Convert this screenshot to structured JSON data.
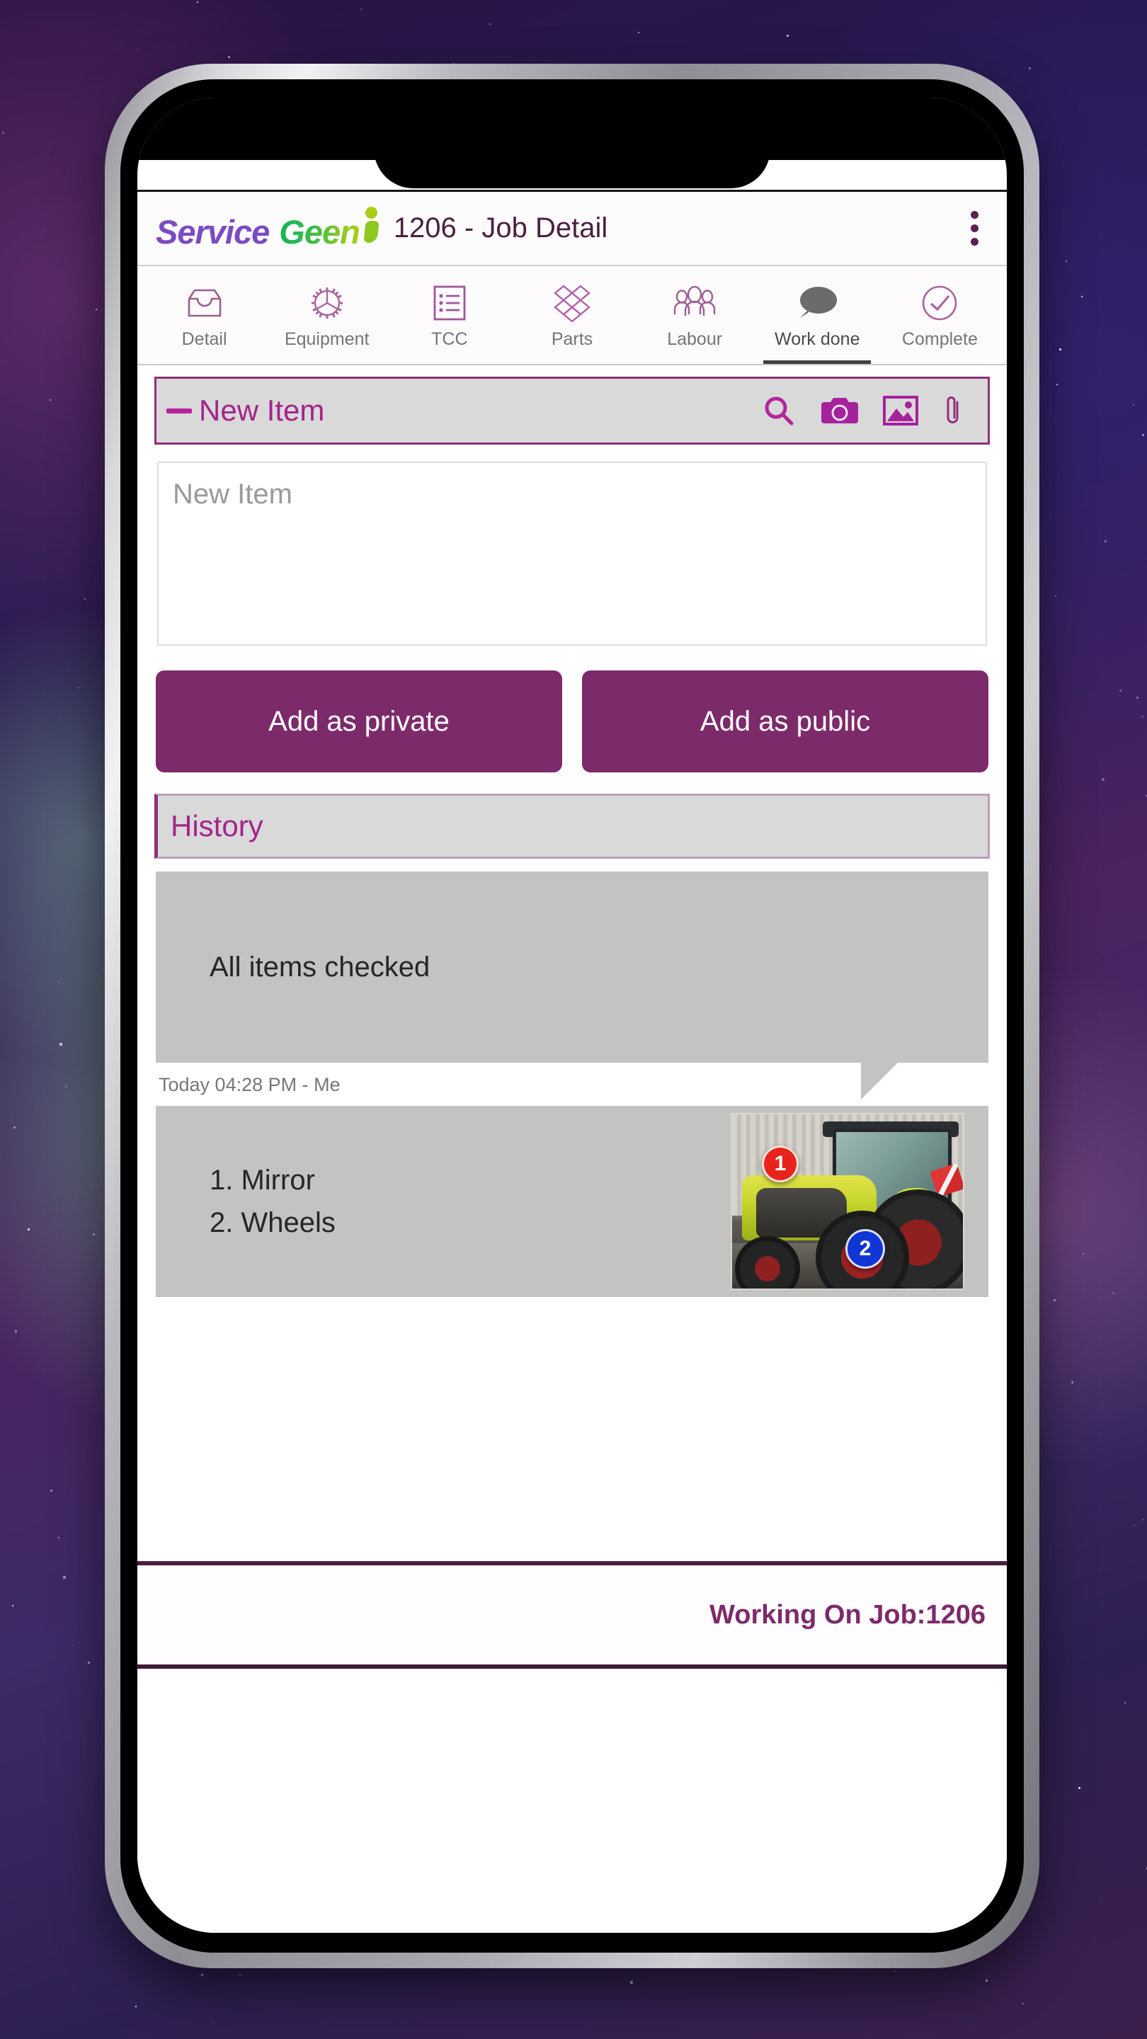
{
  "app": {
    "logo": {
      "part1": "Service",
      "part2": "Geen",
      "person_icon": "person-icon"
    },
    "title": "1206 - Job Detail",
    "menu_icon": "kebab-menu-icon"
  },
  "tabs": [
    {
      "label": "Detail",
      "icon": "inbox-tray-icon",
      "active": false
    },
    {
      "label": "Equipment",
      "icon": "gear-icon",
      "active": false
    },
    {
      "label": "TCC",
      "icon": "checklist-icon",
      "active": false
    },
    {
      "label": "Parts",
      "icon": "parts-boxes-icon",
      "active": false
    },
    {
      "label": "Labour",
      "icon": "people-group-icon",
      "active": false
    },
    {
      "label": "Work done",
      "icon": "speech-bubble-icon",
      "active": true
    },
    {
      "label": "Complete",
      "icon": "check-circle-icon",
      "active": false
    }
  ],
  "new_item_bar": {
    "collapse_icon": "minus-icon",
    "title": "New Item",
    "actions": [
      {
        "name": "search-icon"
      },
      {
        "name": "camera-icon"
      },
      {
        "name": "gallery-image-icon"
      },
      {
        "name": "paperclip-icon"
      }
    ]
  },
  "composer": {
    "placeholder": "New Item",
    "value": "",
    "buttons": {
      "private": "Add as private",
      "public": "Add as public"
    }
  },
  "history": {
    "header": "History",
    "entries": [
      {
        "text": "All items checked",
        "meta": "Today 04:28 PM - Me",
        "has_image": false
      },
      {
        "lines": [
          "1. Mirror",
          "2. Wheels"
        ],
        "has_image": true,
        "image": {
          "alt": "tractor-photo",
          "markers": [
            {
              "label": "1",
              "color": "#e8231b"
            },
            {
              "label": "2",
              "color": "#1036d6"
            }
          ]
        }
      }
    ]
  },
  "footer": {
    "status": "Working On Job:1206"
  },
  "colors": {
    "brand_purple": "#7d2a6b",
    "accent_magenta": "#a3248c",
    "logo_purple": "#7b4bc4",
    "logo_green": "#14b257",
    "bubble_gray": "#c3c3c1"
  }
}
